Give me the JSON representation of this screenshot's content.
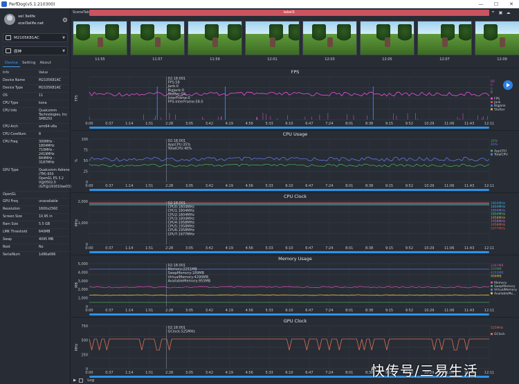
{
  "app": {
    "title": "PerfDog(v5.1.210300)",
    "min": "—",
    "max": "☐",
    "close": "✕"
  },
  "user": {
    "name": "xel 3elife",
    "mail": "xcel3elife.net",
    "icon": "gear-icon"
  },
  "device_select": "M2105K81AC",
  "app_select": "原神",
  "tabs": [
    "Device",
    "Setting",
    "About"
  ],
  "props": {
    "header": {
      "k": "Info",
      "v": "Value"
    },
    "rows": [
      {
        "k": "Device Name",
        "v": "M2105K81AC"
      },
      {
        "k": "Device Type",
        "v": "M2105K81AC"
      },
      {
        "k": "OS",
        "v": "11"
      },
      {
        "k": "CPU Type",
        "v": "kona"
      },
      {
        "k": "CPU Info",
        "v": "Qualcomm\nTechnologies, Inc\nSM8250"
      },
      {
        "k": "CPU Arch",
        "v": "arm64-v8a"
      },
      {
        "k": "CPU CoreNum",
        "v": "8"
      },
      {
        "k": "CPU Freq",
        "v": "300MHz - 1804MHz\n710MHz - 2419MHz\n844MHz - 3187MHz"
      },
      {
        "k": "GPU Type",
        "v": "Qualcomm Adreno\n(TM) 650\nOpenGL ES 3.2\nV@0502.0\n(GIT@191610ae03)"
      },
      {
        "k": "OpenGL",
        "v": ""
      },
      {
        "k": "GPU Freq",
        "v": "unavailable"
      },
      {
        "k": "Resolution",
        "v": "1600x2560"
      },
      {
        "k": "Screen Size",
        "v": "10.95 in"
      },
      {
        "k": "Ram Size",
        "v": "5.5 GB"
      },
      {
        "k": "LMK Threshold",
        "v": "640MB"
      },
      {
        "k": "Swap",
        "v": "4095 MB"
      },
      {
        "k": "Root",
        "v": "No"
      },
      {
        "k": "SerialNum",
        "v": "1d96a066"
      }
    ]
  },
  "scene": {
    "tab": "SceneTab",
    "label": "label1"
  },
  "thumb_times": [
    "11:55",
    "11:57",
    "11:59",
    "12:01",
    "12:03",
    "12:05",
    "12:07",
    "12:09"
  ],
  "x_ticks": [
    "0:00",
    "0:37",
    "1:14",
    "1:51",
    "2:28",
    "3:05",
    "3:42",
    "4:19",
    "4:56",
    "5:33",
    "6:10",
    "6:47",
    "7:24",
    "8:01",
    "8:38",
    "9:15",
    "9:52",
    "10:29",
    "11:06",
    "11:43",
    "12:11"
  ],
  "charts": [
    {
      "title": "FPS",
      "ylabel": "FPS",
      "yticks": [],
      "tooltip": [
        "02:18:001",
        "FPS:58",
        "Jank:0",
        "BigJank:0",
        "Stutter:0%",
        "InterFrame:0",
        "FPS-InterFrame:58.0"
      ],
      "legend_vals": [
        "60",
        "0",
        "0",
        "0"
      ],
      "legend": [
        "FPS",
        "Jank",
        "BigJank",
        "Stutter"
      ],
      "legend_colors": [
        "#d84fc9",
        "#e34b4b",
        "#3a7fff",
        "#e0a640"
      ]
    },
    {
      "title": "CPU Usage",
      "ylabel": "%",
      "yticks": [
        "100",
        "75",
        "50",
        "25",
        "0"
      ],
      "tooltip": [
        "02:18:001",
        "AppCPU:35%",
        "TotalCPU:40%"
      ],
      "legend_vals": [
        "35%",
        "40%"
      ],
      "legend": [
        "AppCPU",
        "TotalCPU"
      ],
      "legend_colors": [
        "#4aa85a",
        "#5f79e0"
      ]
    },
    {
      "title": "CPU Clock",
      "ylabel": "MHz",
      "yticks": [
        "2,000",
        "1,000",
        "0"
      ],
      "tooltip": [
        "02:18:001",
        "CPU0:1804MHz",
        "CPU1:1804MHz",
        "CPU2:1804MHz",
        "CPU3:1804MHz",
        "CPU4:1958MHz",
        "CPU5:1958MHz",
        "CPU6:1958MHz",
        "CPU7:1977MHz"
      ],
      "legend_vals": [
        "1804MHz",
        "1804MHz",
        "1804MHz",
        "1804MHz",
        "1958MHz",
        "1958MHz",
        "1958MHz",
        "1977MHz"
      ],
      "legend": [],
      "legend_colors": [
        "#3fa0ff",
        "#2dc9e0",
        "#7f7fff",
        "#4fd08a",
        "#e0b040",
        "#d86ae0",
        "#e07040",
        "#e05050"
      ]
    },
    {
      "title": "Memory Usage",
      "ylabel": "MB",
      "yticks": [
        "5,000",
        "4,000",
        "3,000",
        "2,000",
        "1,000",
        "0"
      ],
      "tooltip": [
        "02:18:001",
        "Memory:2251MB",
        "SwapMemory:189MB",
        "VirtualMemory:4290MB",
        "AvailableMemory:955MB"
      ],
      "legend_vals": [
        "2367MB",
        "203MB",
        "4293MB",
        "906MB"
      ],
      "legend": [
        "Memory",
        "SwapMemory",
        "VirtualMemory",
        "AvailableMe..."
      ],
      "legend_colors": [
        "#d04fb0",
        "#4aa85a",
        "#5f79e0",
        "#e0c040"
      ]
    },
    {
      "title": "GPU Clock",
      "ylabel": "MHz",
      "yticks": [
        "750",
        "500",
        "250",
        "0"
      ],
      "tooltip": [
        "02:18:001",
        "GClock:525MHz"
      ],
      "legend_vals": [
        "525MHz"
      ],
      "legend": [
        "GClock"
      ],
      "legend_colors": [
        "#e07050"
      ]
    }
  ],
  "bottom": {
    "log": "Log"
  },
  "watermark": "快传号/三易生活",
  "colors": {
    "accent": "#3aa1ff",
    "scene_bar": "#c9535e",
    "slider": "#2f93e6"
  }
}
